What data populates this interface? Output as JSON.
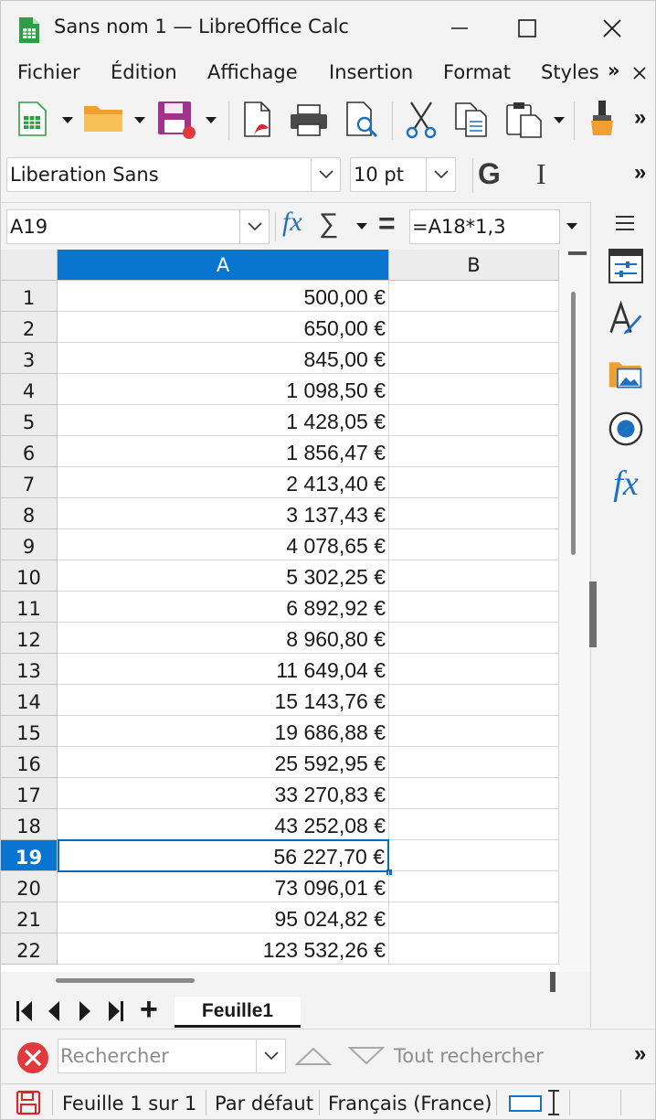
{
  "window": {
    "title": "Sans nom 1 — LibreOffice Calc"
  },
  "menu": {
    "items": [
      "Fichier",
      "Édition",
      "Affichage",
      "Insertion",
      "Format",
      "Styles"
    ],
    "overflow": "»"
  },
  "toolbar": {
    "overflow": "»",
    "font_name": "Liberation Sans",
    "font_size": "10 pt",
    "bold_label": "G",
    "italic_label": "I",
    "icons": [
      "new-spreadsheet-icon",
      "open-folder-icon",
      "save-icon",
      "export-pdf-icon",
      "print-icon",
      "print-preview-icon",
      "cut-icon",
      "copy-icon",
      "paste-icon",
      "clone-formatting-icon"
    ]
  },
  "formula_bar": {
    "name_box": "A19",
    "function_wizard": "fx",
    "sum_symbol": "∑",
    "equals_symbol": "=",
    "formula": "=A18*1,3"
  },
  "sheet": {
    "columns": [
      "A",
      "B"
    ],
    "selected_column": "A",
    "selected_row": "19",
    "rows": [
      {
        "num": "1",
        "a": "500,00 €"
      },
      {
        "num": "2",
        "a": "650,00 €"
      },
      {
        "num": "3",
        "a": "845,00 €"
      },
      {
        "num": "4",
        "a": "1 098,50 €"
      },
      {
        "num": "5",
        "a": "1 428,05 €"
      },
      {
        "num": "6",
        "a": "1 856,47 €"
      },
      {
        "num": "7",
        "a": "2 413,40 €"
      },
      {
        "num": "8",
        "a": "3 137,43 €"
      },
      {
        "num": "9",
        "a": "4 078,65 €"
      },
      {
        "num": "10",
        "a": "5 302,25 €"
      },
      {
        "num": "11",
        "a": "6 892,92 €"
      },
      {
        "num": "12",
        "a": "8 960,80 €"
      },
      {
        "num": "13",
        "a": "11 649,04 €"
      },
      {
        "num": "14",
        "a": "15 143,76 €"
      },
      {
        "num": "15",
        "a": "19 686,88 €"
      },
      {
        "num": "16",
        "a": "25 592,95 €"
      },
      {
        "num": "17",
        "a": "33 270,83 €"
      },
      {
        "num": "18",
        "a": "43 252,08 €"
      },
      {
        "num": "19",
        "a": "56 227,70 €"
      },
      {
        "num": "20",
        "a": "73 096,01 €"
      },
      {
        "num": "21",
        "a": "95 024,82 €"
      },
      {
        "num": "22",
        "a": "123 532,26 €"
      }
    ]
  },
  "sheet_tabs": {
    "add_label": "+",
    "tabs": [
      "Feuille1"
    ]
  },
  "sidebar": {
    "icons": [
      "properties-icon",
      "styles-icon",
      "gallery-icon",
      "navigator-icon",
      "functions-icon"
    ]
  },
  "find_bar": {
    "placeholder": "Rechercher",
    "find_all_label": "Tout rechercher",
    "overflow": "»"
  },
  "status_bar": {
    "sheet_position": "Feuille 1 sur 1",
    "page_style": "Par défaut",
    "language": "Français (France)"
  },
  "colors": {
    "accent": "#0a75d0",
    "chrome": "#f3f3f3",
    "close_red": "#e0393e"
  }
}
